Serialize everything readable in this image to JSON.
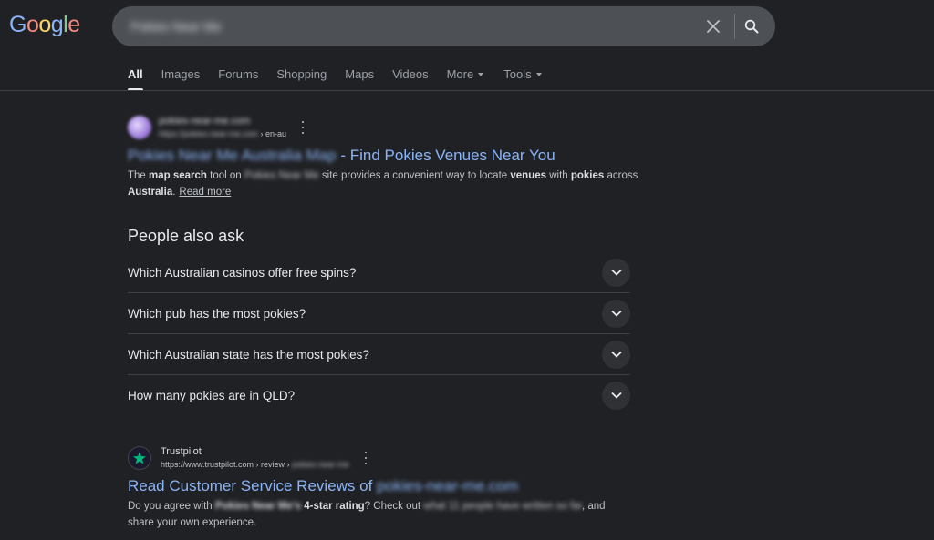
{
  "logo": {
    "letters": [
      "G",
      "o",
      "o",
      "g",
      "l",
      "e"
    ],
    "colors": [
      "#8ab4f8",
      "#f28b82",
      "#fdd663",
      "#8ab4f8",
      "#81c995",
      "#f28b82"
    ]
  },
  "search": {
    "query": "Pokies Near Me"
  },
  "tabs": [
    {
      "label": "All",
      "active": true
    },
    {
      "label": "Images"
    },
    {
      "label": "Forums"
    },
    {
      "label": "Shopping"
    },
    {
      "label": "Maps"
    },
    {
      "label": "Videos"
    },
    {
      "label": "More",
      "dropdown": true
    },
    {
      "label": "Tools",
      "dropdown": true
    }
  ],
  "result1": {
    "site_name": "pokies-near-me.com",
    "url": "https://pokies-near-me.com",
    "url_suffix": " › en-au",
    "title_blurred": "Pokies Near Me Australia Map",
    "title_visible": " - Find Pokies Venues Near You",
    "snippet": {
      "p1": "The ",
      "b1": "map search",
      "p2": " tool on ",
      "blur1": "Pokies Near Me",
      "p3": " site provides a convenient way to locate ",
      "b2": "venues",
      "p4": " with ",
      "b3": "pokies",
      "p5": " across ",
      "b4": "Australia",
      "p6": ".",
      "read_more": "Read more"
    }
  },
  "paa": {
    "title": "People also ask",
    "questions": [
      "Which Australian casinos offer free spins?",
      "Which pub has the most pokies?",
      "Which Australian state has the most pokies?",
      "How many pokies are in QLD?"
    ]
  },
  "result2": {
    "site_name": "Trustpilot",
    "url": "https://www.trustpilot.com",
    "url_suffix": " › review › ",
    "url_blur": "pokies-near-me",
    "title_visible": "Read Customer Service Reviews of ",
    "title_blurred": "pokies-near-me.com",
    "snippet": {
      "p1": "Do you agree with ",
      "b1_blur": "Pokies Near Me's",
      "b2": " 4-star rating",
      "p2": "? Check out ",
      "blur2": "what 11 people have written so far",
      "p3": ", and",
      "p4": "share your own experience."
    }
  },
  "colors": {
    "background": "#202124",
    "link": "#8ab4f8",
    "text": "#bdc1c6"
  }
}
